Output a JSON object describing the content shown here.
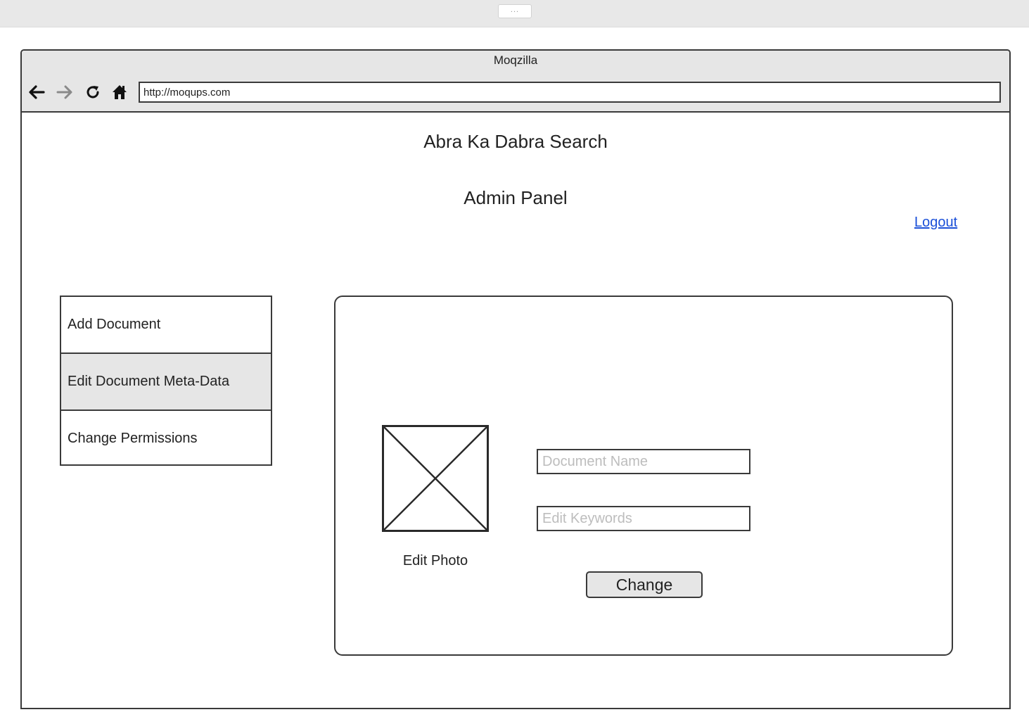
{
  "editor": {
    "handle_label": "..."
  },
  "browser": {
    "title": "Moqzilla",
    "url": "http://moqups.com",
    "icons": [
      "back-arrow-icon",
      "forward-arrow-icon",
      "reload-icon",
      "home-icon"
    ]
  },
  "page": {
    "title": "Abra Ka Dabra Search",
    "subtitle": "Admin Panel",
    "logout_label": "Logout"
  },
  "sidebar": {
    "items": [
      {
        "label": "Add Document",
        "active": false
      },
      {
        "label": "Edit Document Meta-Data",
        "active": true
      },
      {
        "label": "Change Permissions",
        "active": false
      }
    ]
  },
  "form": {
    "photo_caption": "Edit Photo",
    "document_name_placeholder": "Document Name",
    "keywords_placeholder": "Edit Keywords",
    "submit_label": "Change"
  },
  "colors": {
    "accent_link": "#1a4fd8",
    "chrome_bg": "#e6e6e6",
    "border": "#3a3a3a",
    "active_item_bg": "#e6e6e6"
  }
}
